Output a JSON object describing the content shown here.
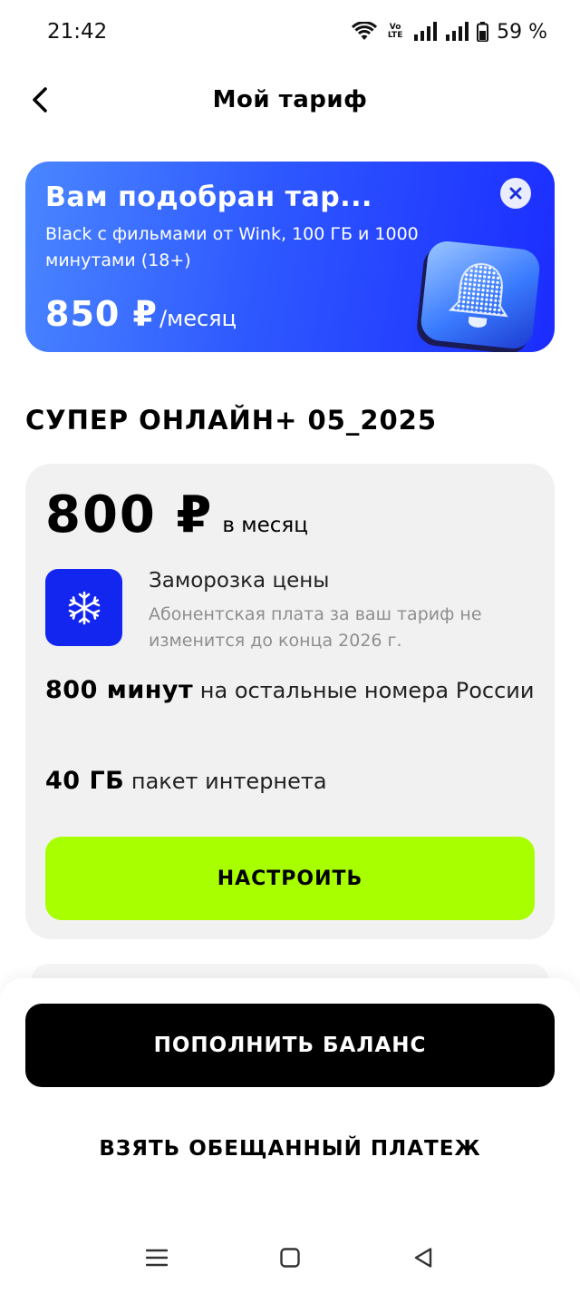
{
  "status_bar": {
    "time": "21:42",
    "volte_top": "Vo",
    "volte_bottom": "LTE",
    "battery": "59 %"
  },
  "header": {
    "title": "Мой тариф"
  },
  "promo": {
    "title": "Вам подобран тар...",
    "description": "Black с фильмами от Wink, 100 ГБ и 1000 минутами (18+)",
    "price": "850 ₽",
    "price_unit": "/месяц",
    "art_icon": "bell-icon",
    "close_icon": "close-icon"
  },
  "tariff": {
    "name": "СУПЕР ОНЛАЙН+ 05_2025",
    "price": "800 ₽",
    "period": "в месяц",
    "freeze": {
      "icon": "snowflake-icon",
      "title": "Заморозка цены",
      "description": "Абонентская плата за ваш тариф не изменится до конца 2026 г."
    },
    "minutes_bold": "800 минут",
    "minutes_text": " на остальные номера России",
    "gb_bold": "40 ГБ",
    "gb_text": " пакет интернета",
    "configure_label": "НАСТРОИТЬ"
  },
  "actions": {
    "topup_label": "ПОПОЛНИТЬ БАЛАНС",
    "promise_label": "ВЗЯТЬ ОБЕЩАННЫЙ ПЛАТЕЖ"
  },
  "colors": {
    "accent_green": "#a7ff00",
    "promo_blue": "#2e58ff",
    "freeze_blue": "#1226f0"
  }
}
